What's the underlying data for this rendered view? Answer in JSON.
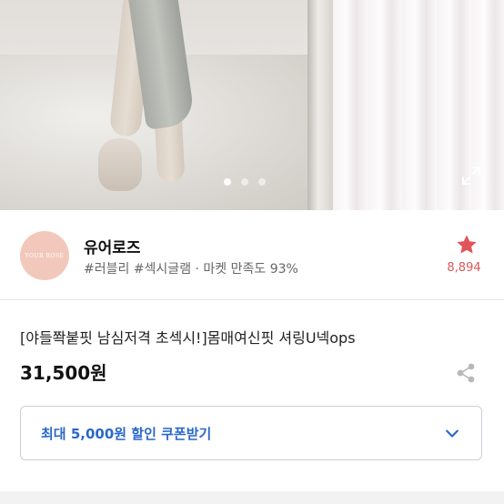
{
  "gallery": {
    "slide_count": 3,
    "active_slide": 1
  },
  "shop": {
    "logo_text": "YOUR ROSE",
    "name": "유어로즈",
    "tags": "#러블리 #섹시글램 · 마켓 만족도 93%",
    "favorite_count": "8,894"
  },
  "product": {
    "title": "[야들쫙붙핏 남심저격 초섹시!]몸매여신핏 셔링U넥ops",
    "price": "31,500원"
  },
  "coupon": {
    "label": "최대 5,000원 할인 쿠폰받기"
  },
  "icons": {
    "expand": "expand-icon",
    "star": "star-icon",
    "share": "share-icon",
    "chevron": "chevron-down-icon"
  },
  "colors": {
    "favorite": "#e0555a",
    "coupon_accent": "#2a68c9",
    "logo_bg": "#f3c8bc"
  }
}
